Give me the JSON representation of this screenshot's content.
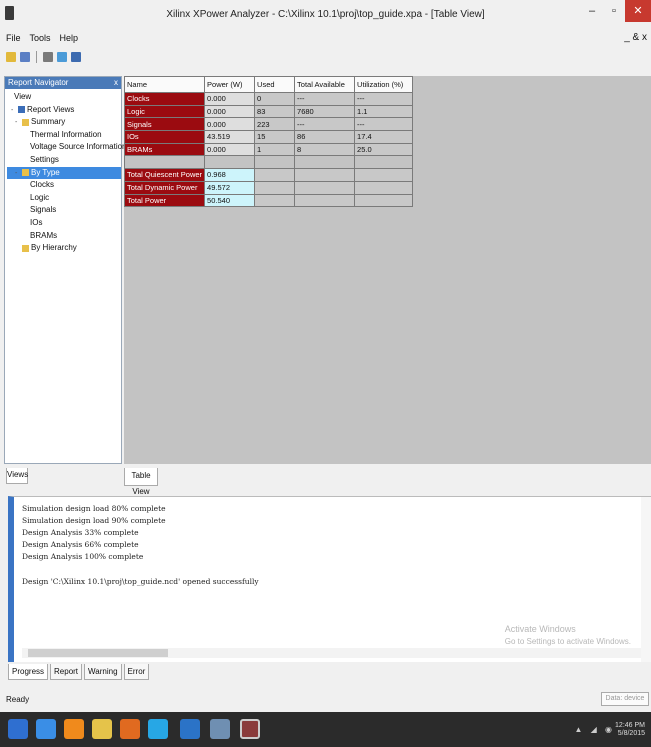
{
  "window": {
    "title": "Xilinx XPower Analyzer - C:\\Xilinx 10.1\\proj\\top_guide.xpa - [Table View]",
    "min_icon": "minimize-icon",
    "max_icon": "maximize-icon",
    "close_icon": "close-icon"
  },
  "menu": {
    "items": [
      "File",
      "Tools",
      "Help"
    ],
    "right_glyph": "_ & x"
  },
  "toolbar": {
    "icons": [
      "open-icon",
      "save-icon",
      "undo-icon",
      "find-icon",
      "print-icon"
    ]
  },
  "left_panel": {
    "title": "Report Navigator",
    "pin": "x",
    "tree": [
      {
        "label": "View",
        "indent": 0,
        "expander": "",
        "icon": ""
      },
      {
        "label": "Report Views",
        "indent": 1,
        "expander": "-",
        "icon": "blue"
      },
      {
        "label": "Summary",
        "indent": 2,
        "expander": "-",
        "icon": "folder"
      },
      {
        "label": "Thermal Information",
        "indent": 4,
        "expander": "",
        "icon": ""
      },
      {
        "label": "Voltage Source Information",
        "indent": 4,
        "expander": "",
        "icon": ""
      },
      {
        "label": "Settings",
        "indent": 4,
        "expander": "",
        "icon": ""
      },
      {
        "label": "By Type",
        "indent": 2,
        "expander": "-",
        "icon": "folder",
        "selected": true
      },
      {
        "label": "Clocks",
        "indent": 4,
        "expander": "",
        "icon": ""
      },
      {
        "label": "Logic",
        "indent": 4,
        "expander": "",
        "icon": ""
      },
      {
        "label": "Signals",
        "indent": 4,
        "expander": "",
        "icon": ""
      },
      {
        "label": "IOs",
        "indent": 4,
        "expander": "",
        "icon": ""
      },
      {
        "label": "BRAMs",
        "indent": 4,
        "expander": "",
        "icon": ""
      },
      {
        "label": "By Hierarchy",
        "indent": 2,
        "expander": "",
        "icon": "folder"
      }
    ],
    "tab_label": "Views"
  },
  "table": {
    "headers": [
      "Name",
      "Power (W)",
      "Used",
      "Total Available",
      "Utilization (%)"
    ],
    "rows": [
      [
        "Clocks",
        "0.000",
        "0",
        "---",
        "---"
      ],
      [
        "Logic",
        "0.000",
        "83",
        "7680",
        "1.1"
      ],
      [
        "Signals",
        "0.000",
        "223",
        "---",
        "---"
      ],
      [
        "IOs",
        "43.519",
        "15",
        "86",
        "17.4"
      ],
      [
        "BRAMs",
        "0.000",
        "1",
        "8",
        "25.0"
      ]
    ],
    "totals": [
      [
        "Total Quiescent Power",
        "0.968"
      ],
      [
        "Total Dynamic Power",
        "49.572"
      ],
      [
        "Total Power",
        "50.540"
      ]
    ],
    "tab_label": "Table View"
  },
  "console": {
    "lines": [
      "Simulation design load 80% complete",
      "Simulation design load 90% complete",
      "Design Analysis 33% complete",
      "Design Analysis 66% complete",
      "Design Analysis 100% complete"
    ],
    "final_line": "Design 'C:\\Xilinx 10.1\\proj\\top_guide.ncd' opened successfully",
    "watermark_1": "Activate Windows",
    "watermark_2": "Go to Settings to activate Windows."
  },
  "console_tabs": [
    "Progress",
    "Report",
    "Warning",
    "Error"
  ],
  "status": {
    "text": "Ready",
    "box": "Data: device"
  },
  "taskbar": {
    "time": "12:46 PM",
    "date": "5/8/2015",
    "icons": [
      "windows-start-icon",
      "ie-icon",
      "vlc-icon",
      "explorer-icon",
      "matlab-icon",
      "skype-icon",
      "xpa-icon",
      "app-icon",
      "xilinx-icon"
    ]
  },
  "colors": {
    "accent": "#3e8ae0",
    "row_header": "#9b0b10",
    "total_value": "#cdf4fb"
  }
}
